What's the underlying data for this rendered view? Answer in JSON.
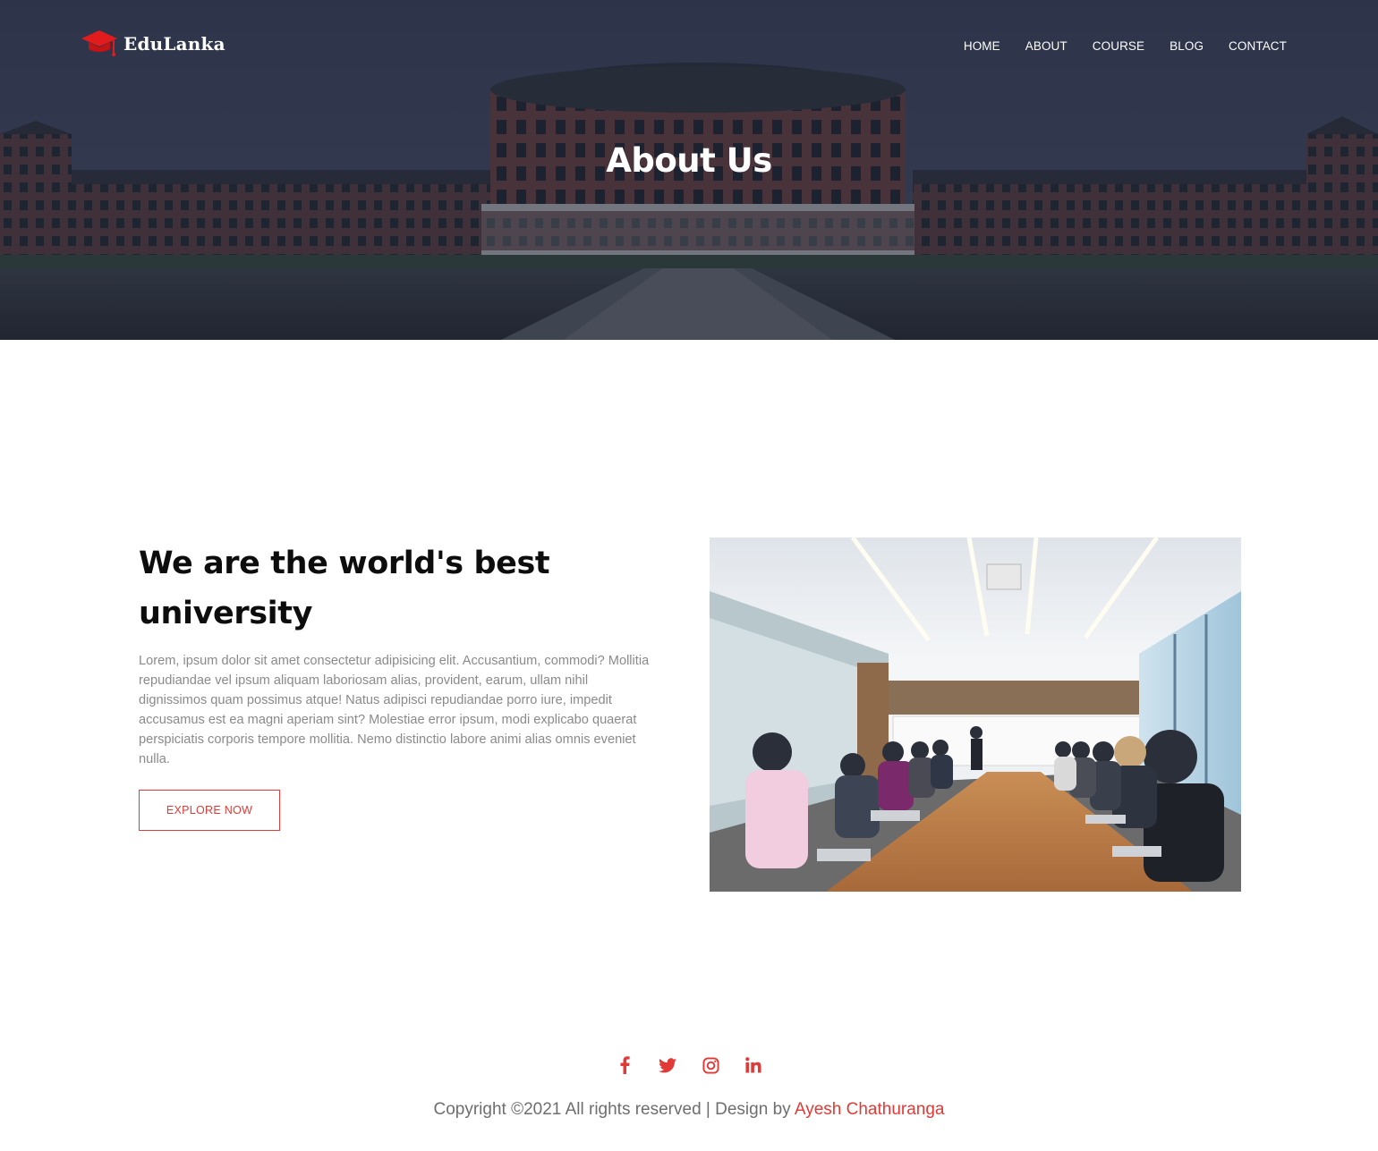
{
  "brand": {
    "name": "EduLanka",
    "icon": "graduation-cap-icon",
    "accent": "#e23a36"
  },
  "nav": {
    "items": [
      "HOME",
      "ABOUT",
      "COURSE",
      "BLOG",
      "CONTACT"
    ]
  },
  "hero": {
    "title": "About Us"
  },
  "about": {
    "heading": "We are the world's best university",
    "text": "Lorem, ipsum dolor sit amet consectetur adipisicing elit. Accusantium, commodi? Mollitia repudiandae vel ipsum aliquam laboriosam alias, provident, earum, ullam nihil dignissimos quam possimus atque! Natus adipisci repudiandae porro iure, impedit accusamus est ea magni aperiam sint? Molestiae error ipsum, modi explicabo quaerat perspiciatis corporis tempore mollitia. Nemo distinctio labore animi alias omnis eveniet nulla.",
    "button_label": "EXPLORE NOW"
  },
  "footer": {
    "socials": [
      "facebook-icon",
      "twitter-icon",
      "instagram-icon",
      "linkedin-icon"
    ],
    "copyright_prefix": "Copyright ©2021 All rights reserved | Design by ",
    "author": "Ayesh Chathuranga"
  }
}
